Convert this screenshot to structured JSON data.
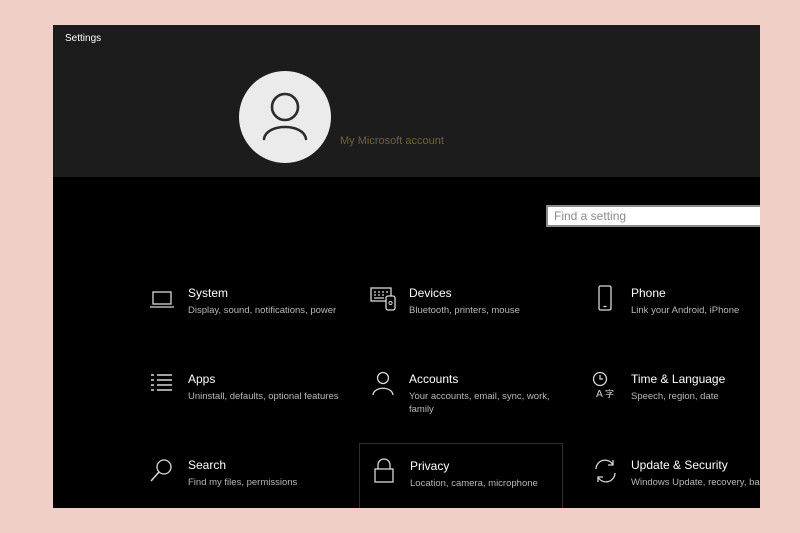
{
  "window": {
    "title": "Settings"
  },
  "account": {
    "link_label": "My Microsoft account"
  },
  "search": {
    "placeholder": "Find a setting"
  },
  "tiles": [
    {
      "name": "System",
      "description": "Display, sound, notifications, power",
      "icon": "laptop-icon"
    },
    {
      "name": "Devices",
      "description": "Bluetooth, printers, mouse",
      "icon": "keyboard-devices-icon"
    },
    {
      "name": "Phone",
      "description": "Link your Android, iPhone",
      "icon": "phone-icon"
    },
    {
      "name": "Apps",
      "description": "Uninstall, defaults, optional features",
      "icon": "apps-list-icon"
    },
    {
      "name": "Accounts",
      "description": "Your accounts, email, sync, work, family",
      "icon": "person-icon"
    },
    {
      "name": "Time & Language",
      "description": "Speech, region, date",
      "icon": "time-language-icon"
    },
    {
      "name": "Search",
      "description": "Find my files, permissions",
      "icon": "magnifier-icon"
    },
    {
      "name": "Privacy",
      "description": "Location, camera, microphone",
      "icon": "lock-icon"
    },
    {
      "name": "Update & Security",
      "description": "Windows Update, recovery, backup",
      "icon": "sync-arrows-icon"
    }
  ]
}
